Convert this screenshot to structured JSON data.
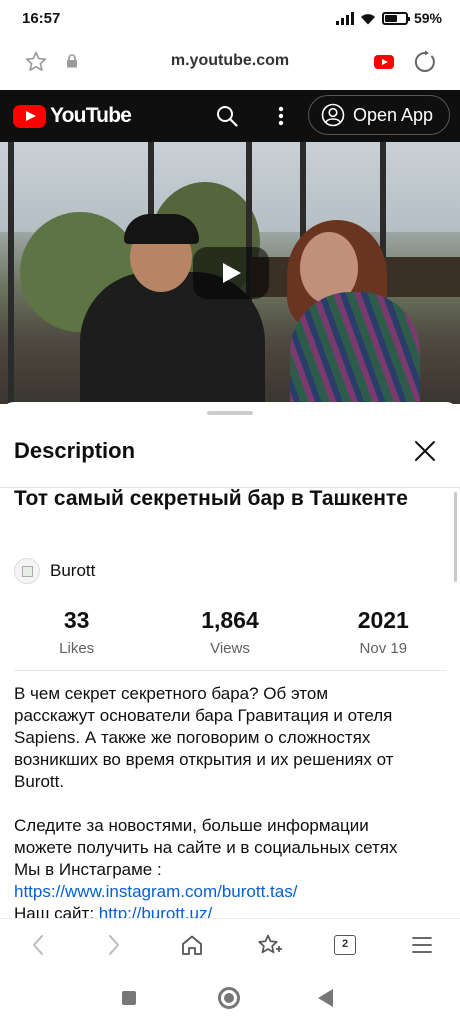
{
  "status_bar": {
    "time": "16:57",
    "battery": "59%",
    "battery_level": 0.59
  },
  "browser": {
    "url": "m.youtube.com"
  },
  "youtube_header": {
    "logo_text": "YouTube",
    "open_app_label": "Open App"
  },
  "sheet": {
    "title": "Description",
    "video_title": "Тот самый секретный бар в Ташкенте",
    "channel_name": "Burott",
    "stats": [
      {
        "value": "33",
        "label": "Likes"
      },
      {
        "value": "1,864",
        "label": "Views"
      },
      {
        "value": "2021",
        "label": "Nov 19"
      }
    ],
    "description_paragraph_1": [
      "В чем секрет секретного бара? Об этом",
      "расскажут основатели бара Гравитация и отеля",
      "Sapiens. А также же поговорим о сложностях",
      "возникших во время открытия и их решениях от",
      "Burott."
    ],
    "description_paragraph_2": [
      "Следите за новостями, больше информации",
      "можете получить на сайте и в социальных сетях",
      "Мы в Инстаграме :"
    ],
    "instagram_link": "https://www.instagram.com/burott.tas/",
    "site_label": "Наш сайт:",
    "site_link": "http://burott.uz/"
  },
  "bottom_toolbar": {
    "tab_count": "2"
  },
  "colors": {
    "youtube_red": "#ff0000",
    "link_blue": "#065fd4",
    "header_bg": "#0f0f0f"
  },
  "icons": [
    "star-icon",
    "lock-icon",
    "youtube-icon",
    "reload-icon",
    "search-icon",
    "more-vert-icon",
    "account-icon",
    "play-icon",
    "close-icon",
    "back-icon",
    "forward-icon",
    "home-icon",
    "bookmark-star-icon",
    "tabs-icon",
    "menu-icon"
  ]
}
